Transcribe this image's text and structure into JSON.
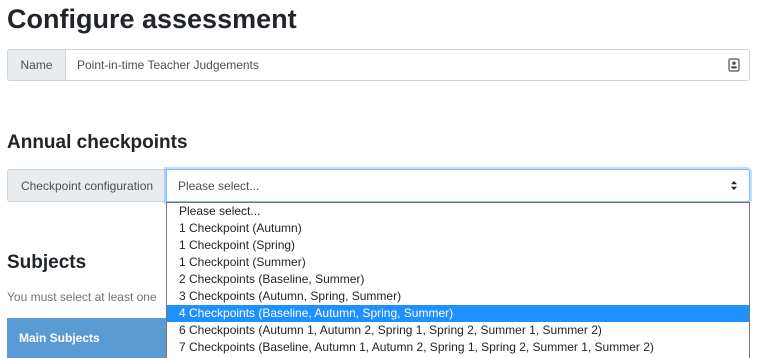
{
  "page": {
    "title": "Configure assessment"
  },
  "name_field": {
    "label": "Name",
    "value": "Point-in-time Teacher Judgements",
    "icon": "contact-card-icon"
  },
  "checkpoints_section": {
    "heading": "Annual checkpoints",
    "config_label": "Checkpoint configuration",
    "selected_value": "Please select...",
    "options": [
      "Please select...",
      "1 Checkpoint (Autumn)",
      "1 Checkpoint (Spring)",
      "1 Checkpoint (Summer)",
      "2 Checkpoints (Baseline, Summer)",
      "3 Checkpoints (Autumn, Spring, Summer)",
      "4 Checkpoints (Baseline, Autumn, Spring, Summer)",
      "6 Checkpoints (Autumn 1, Autumn 2, Spring 1, Spring 2, Summer 1, Summer 2)",
      "7 Checkpoints (Baseline, Autumn 1, Autumn 2, Spring 1, Spring 2, Summer 1, Summer 2)"
    ],
    "highlighted_index": 6
  },
  "subjects_section": {
    "heading": "Subjects",
    "helper_text": "You must select at least one",
    "table_header": "Main Subjects"
  },
  "colors": {
    "highlight": "#1e90ff",
    "table_header": "#5b9bd5",
    "focus_border": "#80bdff"
  }
}
